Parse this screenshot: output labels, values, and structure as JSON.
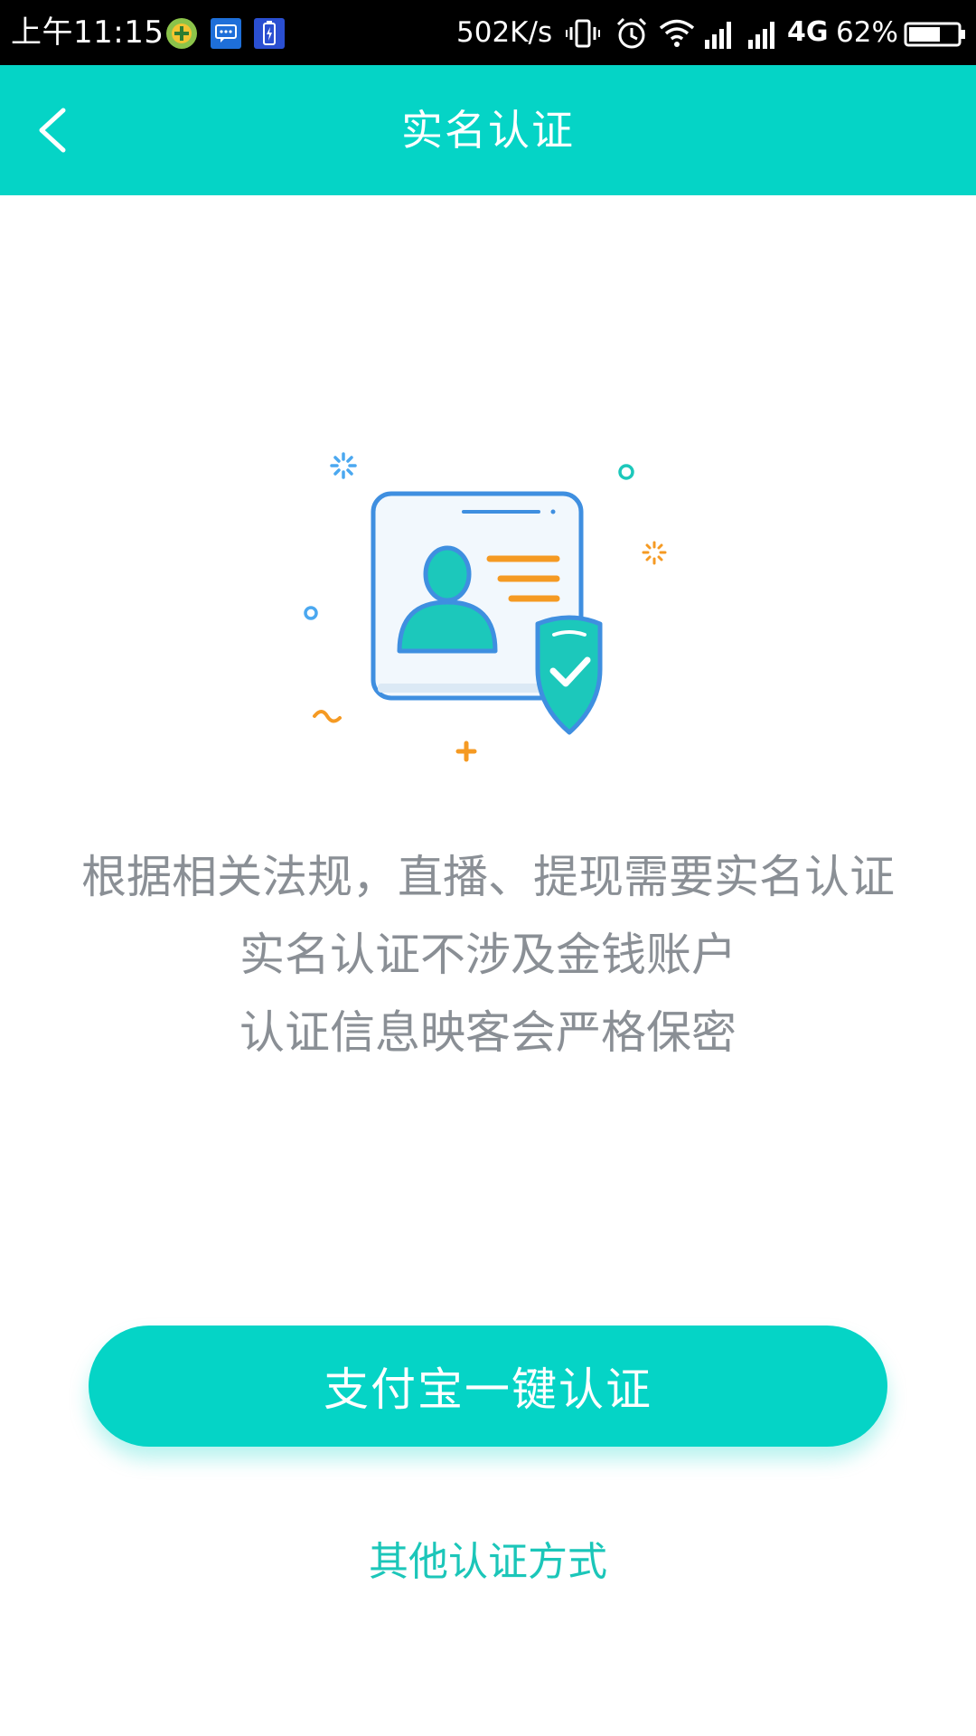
{
  "status_bar": {
    "time": "上午11:15",
    "net_speed": "502K/s",
    "network_type": "4G",
    "battery": "62%",
    "icons": [
      "app-notification-icon",
      "message-notification-icon",
      "battery-saver-notification-icon",
      "vibrate-icon",
      "alarm-icon",
      "wifi-icon",
      "signal-icon",
      "signal-icon",
      "battery-icon"
    ]
  },
  "header": {
    "title": "实名认证",
    "back_icon": "chevron-left-icon"
  },
  "illustration": {
    "icon": "id-card-verified-icon"
  },
  "info": {
    "line1": "根据相关法规，直播、提现需要实名认证",
    "line2": "实名认证不涉及金钱账户",
    "line3": "认证信息映客会严格保密"
  },
  "actions": {
    "primary_label": "支付宝一键认证",
    "secondary_label": "其他认证方式"
  },
  "colors": {
    "accent": "#05d4c6",
    "text_gray": "#8a8f95",
    "link_teal": "#1bc6b9"
  }
}
